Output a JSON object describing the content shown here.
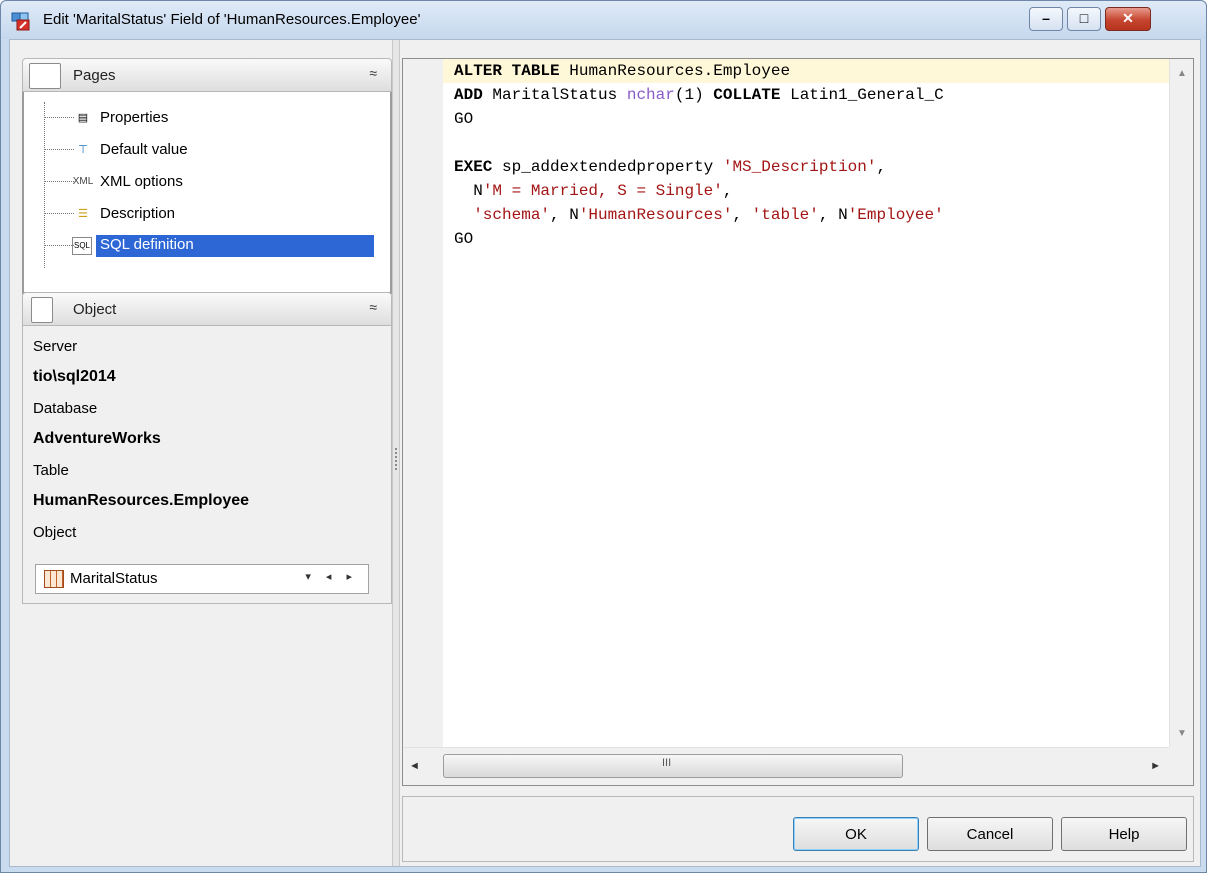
{
  "window": {
    "title": "Edit 'MaritalStatus' Field of 'HumanResources.Employee'",
    "controls": {
      "minimize": "–",
      "maximize": "□",
      "close": "✕"
    }
  },
  "pages_panel": {
    "title": "Pages",
    "collapse_glyph": "≈",
    "items": [
      {
        "label": "Properties",
        "icon": "properties-icon",
        "glyph": "▤"
      },
      {
        "label": "Default value",
        "icon": "default-value-icon",
        "glyph": "⊤"
      },
      {
        "label": "XML options",
        "icon": "xml-icon",
        "glyph": "XML"
      },
      {
        "label": "Description",
        "icon": "description-icon",
        "glyph": "☰"
      },
      {
        "label": "SQL definition",
        "icon": "sql-icon",
        "glyph": "SQL",
        "selected": true
      }
    ]
  },
  "object_panel": {
    "title": "Object",
    "collapse_glyph": "≈",
    "server_label": "Server",
    "server_value": "tio\\sql2014",
    "database_label": "Database",
    "database_value": "AdventureWorks",
    "table_label": "Table",
    "table_value": "HumanResources.Employee",
    "object_label": "Object",
    "object_value": "MaritalStatus",
    "object_arrows": "▾ ◂ ▸"
  },
  "editor": {
    "lines": [
      "ALTER TABLE HumanResources.Employee",
      "ADD MaritalStatus nchar(1) COLLATE Latin1_General_C",
      "GO",
      "",
      "EXEC sp_addextendedproperty 'MS_Description',",
      "  N'M = Married, S = Single',",
      "  'schema', N'HumanResources', 'table', N'Employee'",
      "GO"
    ],
    "scroll_up": "▲",
    "scroll_down": "▼",
    "scroll_left": "◄",
    "scroll_right": "►",
    "thumb_grip": "III"
  },
  "buttons": {
    "ok": "OK",
    "cancel": "Cancel",
    "help": "Help"
  }
}
